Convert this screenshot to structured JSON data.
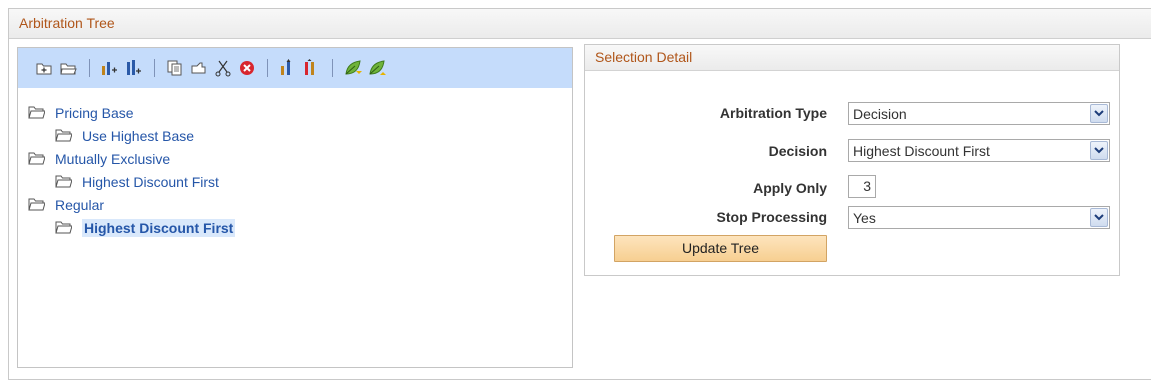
{
  "outer": {
    "title": "Arbitration Tree"
  },
  "toolbar": {
    "icons": [
      "insert-child-folder-icon",
      "insert-sibling-folder-icon",
      "insert-child-node-icon",
      "insert-sibling-node-icon",
      "copy-icon",
      "paste-icon",
      "cut-icon",
      "delete-icon",
      "move-up-icon",
      "move-down-icon",
      "expand-leaf-icon",
      "collapse-leaf-icon"
    ]
  },
  "tree": {
    "nodes": [
      {
        "label": "Pricing Base",
        "level": 0
      },
      {
        "label": "Use Highest Base",
        "level": 1
      },
      {
        "label": "Mutually Exclusive",
        "level": 0
      },
      {
        "label": "Highest Discount First",
        "level": 1
      },
      {
        "label": "Regular",
        "level": 0
      },
      {
        "label": "Highest Discount First",
        "level": 1,
        "selected": true
      }
    ]
  },
  "detail": {
    "title": "Selection Detail",
    "arbitration_type_label": "Arbitration Type",
    "arbitration_type_value": "Decision",
    "decision_label": "Decision",
    "decision_value": "Highest Discount First",
    "apply_only_label": "Apply Only",
    "apply_only_value": "3",
    "stop_processing_label": "Stop Processing",
    "stop_processing_value": "Yes",
    "update_button": "Update Tree"
  },
  "colors": {
    "accent_title": "#b0561a",
    "link": "#2556a8",
    "toolbar_bg": "#c5dcfb",
    "button_bg": "#f7cf91"
  }
}
